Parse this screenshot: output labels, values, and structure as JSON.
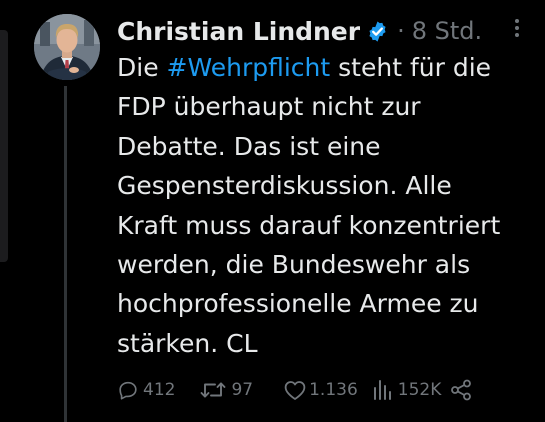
{
  "tweet": {
    "author_name": "Christian Lindner",
    "separator": "·",
    "time": "8 Std.",
    "text_prefix": "Die ",
    "hashtag": "#Wehrpflicht",
    "text_after_hashtag": " steht für die",
    "text_lines": [
      "FDP überhaupt nicht zur",
      "Debatte. Das ist eine",
      "Gespensterdiskussion. Alle",
      "Kraft muss darauf konzentriert",
      "werden, die Bundeswehr als",
      "hochprofessionelle Armee zu",
      "stärken. CL"
    ]
  },
  "stats": {
    "replies": "412",
    "retweets": "97",
    "likes": "1.136",
    "views": "152K"
  },
  "icons": {
    "verified": "verified-badge-icon",
    "more": "more-vertical-icon",
    "reply": "reply-bubble-icon",
    "retweet": "retweet-icon",
    "like": "heart-icon",
    "views": "views-bar-chart-icon",
    "share": "share-icon"
  },
  "colors": {
    "background": "#000000",
    "text": "#e7e9ea",
    "muted": "#71767b",
    "accent": "#1d9bf0"
  }
}
